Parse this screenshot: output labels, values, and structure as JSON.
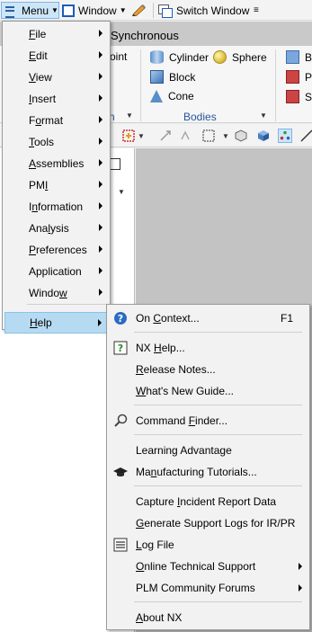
{
  "toolbar": {
    "menu_label": "Menu",
    "window_label": "Window",
    "switch_window_label": "Switch Window"
  },
  "ribbon": {
    "tab_label": "Synchronous",
    "left_partial_label": "oint",
    "left_group_partial": "n",
    "items": {
      "cylinder": "Cylinder",
      "sphere": "Sphere",
      "block": "Block",
      "cone": "Cone",
      "right1": "Bo",
      "right2": "Pa",
      "right3": "Sl"
    },
    "group_label": "Bodies"
  },
  "main_menu": {
    "items": [
      {
        "pre": "",
        "u": "F",
        "post": "ile"
      },
      {
        "pre": "",
        "u": "E",
        "post": "dit"
      },
      {
        "pre": "",
        "u": "V",
        "post": "iew"
      },
      {
        "pre": "",
        "u": "I",
        "post": "nsert"
      },
      {
        "pre": "F",
        "u": "o",
        "post": "rmat"
      },
      {
        "pre": "",
        "u": "T",
        "post": "ools"
      },
      {
        "pre": "",
        "u": "A",
        "post": "ssemblies"
      },
      {
        "pre": "PM",
        "u": "I",
        "post": ""
      },
      {
        "pre": "I",
        "u": "n",
        "post": "formation"
      },
      {
        "pre": "Ana",
        "u": "l",
        "post": "ysis"
      },
      {
        "pre": "",
        "u": "P",
        "post": "references"
      },
      {
        "pre": "Application",
        "u": "",
        "post": ""
      },
      {
        "pre": "Windo",
        "u": "w",
        "post": ""
      },
      {
        "pre": "",
        "u": "H",
        "post": "elp"
      }
    ]
  },
  "help_menu": {
    "on_context": {
      "pre": "On ",
      "u": "C",
      "post": "ontext...",
      "shortcut": "F1"
    },
    "nx_help": {
      "pre": "NX ",
      "u": "H",
      "post": "elp..."
    },
    "release_notes": {
      "pre": "",
      "u": "R",
      "post": "elease Notes..."
    },
    "whats_new": {
      "pre": "",
      "u": "W",
      "post": "hat's New Guide..."
    },
    "command_finder": {
      "pre": "Command ",
      "u": "F",
      "post": "inder..."
    },
    "learning_advantage": {
      "pre": "Learning Advantage",
      "u": "",
      "post": ""
    },
    "mfg_tutorials": {
      "pre": "Ma",
      "u": "n",
      "post": "ufacturing Tutorials..."
    },
    "capture_incident": {
      "pre": "Capture ",
      "u": "I",
      "post": "ncident Report Data"
    },
    "support_logs": {
      "pre": "",
      "u": "G",
      "post": "enerate Support Logs for IR/PR"
    },
    "log_file": {
      "pre": "",
      "u": "L",
      "post": "og File"
    },
    "online_support": {
      "pre": "",
      "u": "O",
      "post": "nline Technical Support"
    },
    "plm_forums": {
      "pre": "PLM Community Forums",
      "u": "",
      "post": ""
    },
    "about_nx": {
      "pre": "",
      "u": "A",
      "post": "bout NX"
    }
  }
}
